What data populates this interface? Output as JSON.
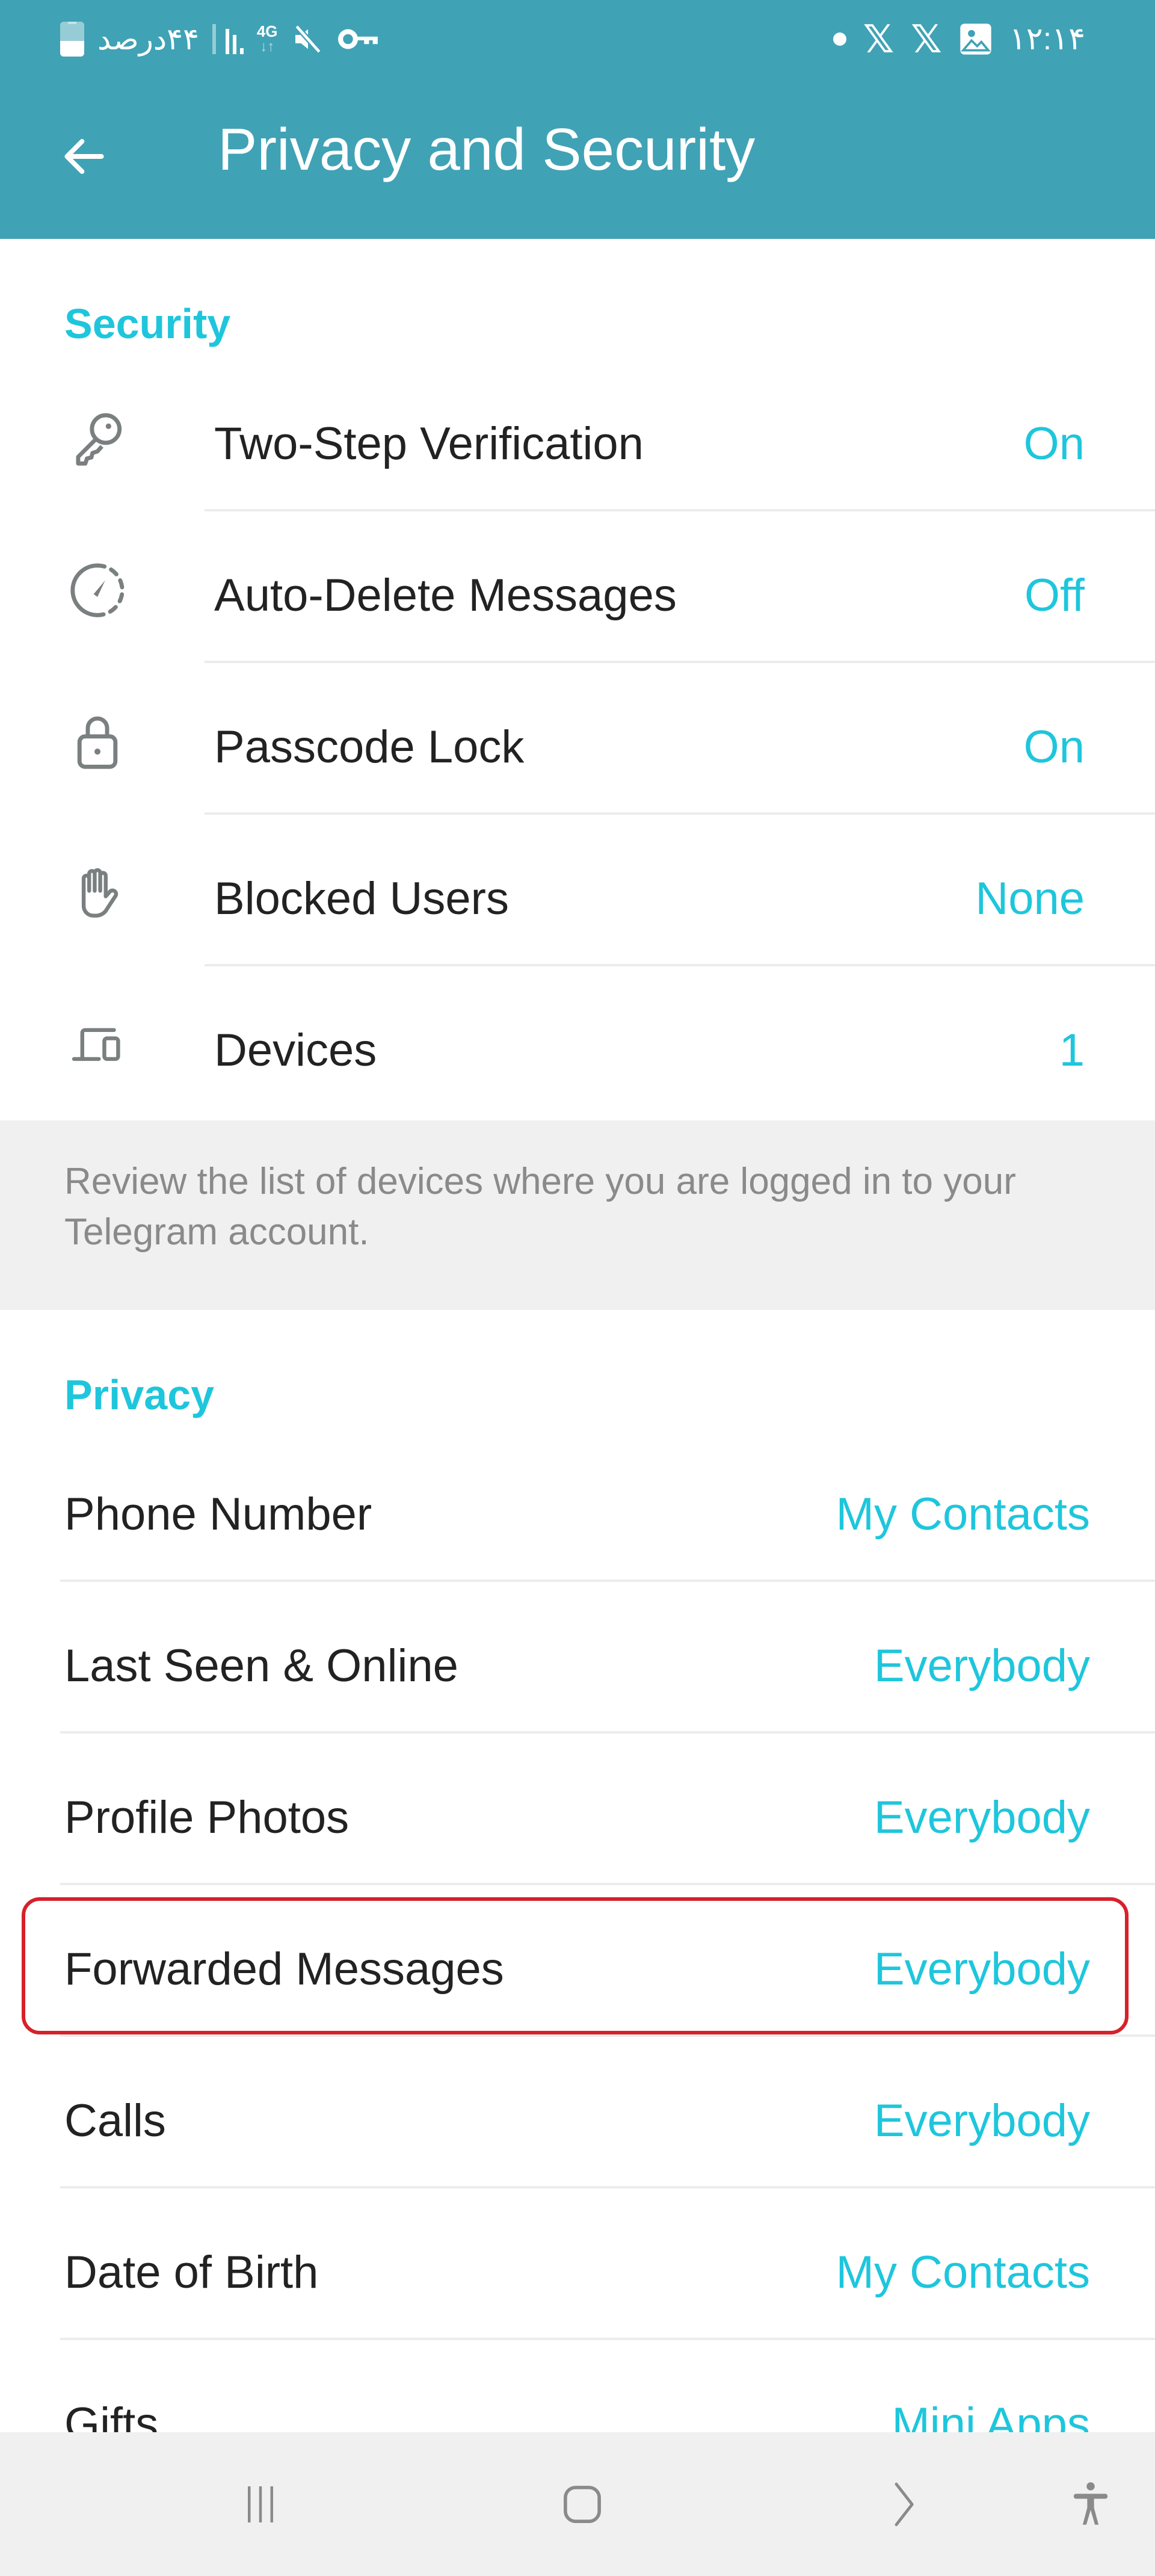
{
  "status_bar": {
    "battery_text": "۴۴درصد",
    "battery_level_percent": 44,
    "network_type": "4G",
    "time": "۱۲:۱۴",
    "left_icons": [
      "battery-icon",
      "signal-icon",
      "network-4g-icon",
      "mute-icon",
      "vpn-key-icon"
    ],
    "right_icons": [
      "notification-dot-icon",
      "x-app-icon",
      "x-app-icon",
      "gallery-icon"
    ]
  },
  "app_bar": {
    "title": "Privacy and Security",
    "back_icon": "arrow-left-icon",
    "background_color": "#40a2b5"
  },
  "colors": {
    "accent": "#1ec6dc",
    "highlight": "#d6212b",
    "label": "#222222",
    "info_text": "#8a8a8a",
    "info_background": "#f0f0f0"
  },
  "security": {
    "header": "Security",
    "items": [
      {
        "icon": "key-icon",
        "label": "Two-Step Verification",
        "value": "On"
      },
      {
        "icon": "auto-delete-timer-icon",
        "label": "Auto-Delete Messages",
        "value": "Off"
      },
      {
        "icon": "lock-icon",
        "label": "Passcode Lock",
        "value": "On"
      },
      {
        "icon": "hand-block-icon",
        "label": "Blocked Users",
        "value": "None"
      },
      {
        "icon": "devices-icon",
        "label": "Devices",
        "value": "1"
      }
    ],
    "info": "Review the list of devices where you are logged in to your Telegram account."
  },
  "privacy": {
    "header": "Privacy",
    "items": [
      {
        "label": "Phone Number",
        "value": "My Contacts"
      },
      {
        "label": "Last Seen & Online",
        "value": "Everybody"
      },
      {
        "label": "Profile Photos",
        "value": "Everybody"
      },
      {
        "label": "Forwarded Messages",
        "value": "Everybody",
        "highlighted": true
      },
      {
        "label": "Calls",
        "value": "Everybody"
      },
      {
        "label": "Date of Birth",
        "value": "My Contacts"
      },
      {
        "label": "Gifts",
        "value": "Mini Apps"
      }
    ]
  },
  "nav_bar": {
    "buttons": [
      "recent-apps-icon",
      "home-icon",
      "back-chevron-icon",
      "accessibility-icon"
    ]
  }
}
